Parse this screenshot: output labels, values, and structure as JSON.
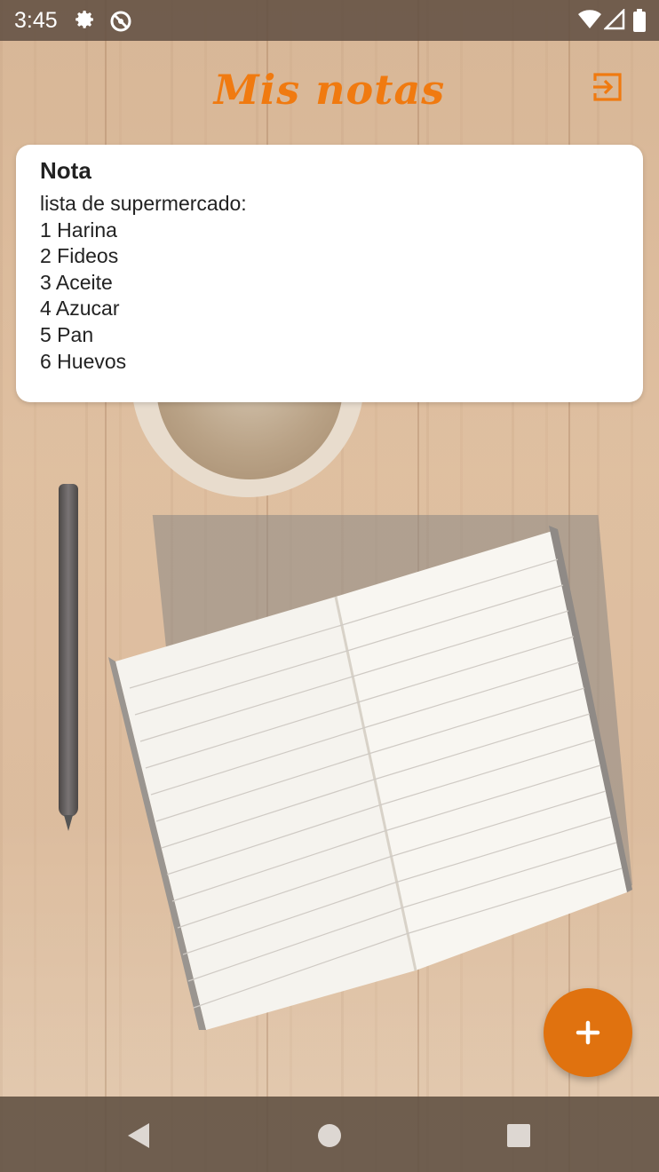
{
  "status_bar": {
    "time": "3:45",
    "left_icons": [
      "gear-icon",
      "no-sync-icon"
    ],
    "right_icons": [
      "wifi-icon",
      "signal-icon",
      "battery-icon"
    ]
  },
  "header": {
    "title": "Mis notas",
    "logout_icon": "logout-icon"
  },
  "notes": [
    {
      "title": "Nota",
      "body": "lista de supermercado:\n1 Harina\n2 Fideos\n3 Aceite\n4 Azucar\n5 Pan\n6 Huevos"
    }
  ],
  "fab": {
    "icon": "plus-icon"
  },
  "nav_bar": {
    "buttons": [
      "back-icon",
      "home-icon",
      "recents-icon"
    ]
  },
  "colors": {
    "accent": "#f07a10",
    "fab": "#e0720f",
    "card": "#ffffff",
    "status_bar": "#5f4e41"
  }
}
